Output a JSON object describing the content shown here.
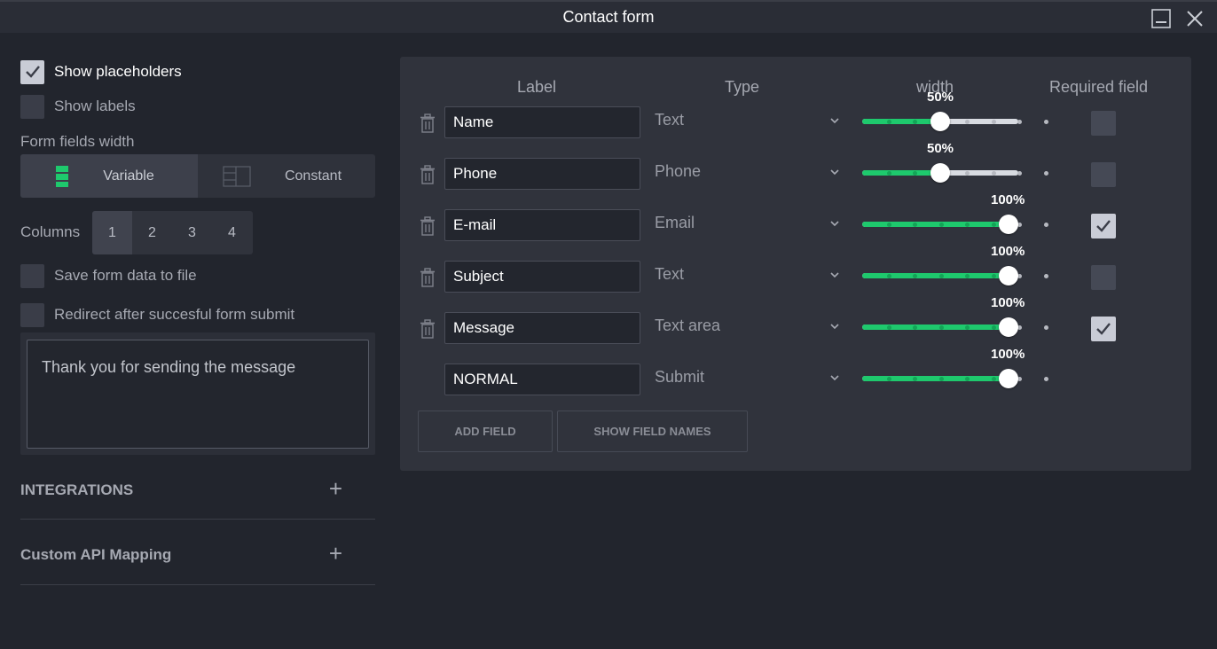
{
  "window": {
    "title": "Contact form"
  },
  "left": {
    "show_placeholders": {
      "label": "Show placeholders",
      "checked": true
    },
    "show_labels": {
      "label": "Show labels",
      "checked": false
    },
    "form_fields_width_label": "Form fields width",
    "width_modes": [
      {
        "label": "Variable",
        "icon": "variable-width-icon",
        "active": true
      },
      {
        "label": "Constant",
        "icon": "constant-width-icon",
        "active": false
      }
    ],
    "columns_label": "Columns",
    "columns": [
      "1",
      "2",
      "3",
      "4"
    ],
    "columns_selected": "1",
    "save_form_data": {
      "label": "Save form data to file",
      "checked": false
    },
    "redirect": {
      "label": "Redirect after succesful form submit",
      "checked": false
    },
    "thank_you_message": "Thank you for sending the message",
    "integrations_label": "INTEGRATIONS",
    "custom_api_label": "Custom API Mapping"
  },
  "table": {
    "headers": {
      "label": "Label",
      "type": "Type",
      "width": "width",
      "required": "Required field"
    },
    "rows": [
      {
        "label": "Name",
        "type": "Text",
        "width_pct": 50,
        "width_text": "50%",
        "required": false,
        "deletable": true
      },
      {
        "label": "Phone",
        "type": "Phone",
        "width_pct": 50,
        "width_text": "50%",
        "required": false,
        "deletable": true
      },
      {
        "label": "E-mail",
        "type": "Email",
        "width_pct": 100,
        "width_text": "100%",
        "required": true,
        "deletable": true
      },
      {
        "label": "Subject",
        "type": "Text",
        "width_pct": 100,
        "width_text": "100%",
        "required": false,
        "deletable": true
      },
      {
        "label": "Message",
        "type": "Text area",
        "width_pct": 100,
        "width_text": "100%",
        "required": true,
        "deletable": true
      },
      {
        "label": "NORMAL",
        "type": "Submit",
        "width_pct": 100,
        "width_text": "100%",
        "required": null,
        "deletable": false
      }
    ],
    "add_field_label": "ADD FIELD",
    "show_field_names_label": "SHOW FIELD NAMES"
  },
  "colors": {
    "accent": "#1ec96d",
    "panel": "#30333c",
    "background": "#22252d"
  }
}
